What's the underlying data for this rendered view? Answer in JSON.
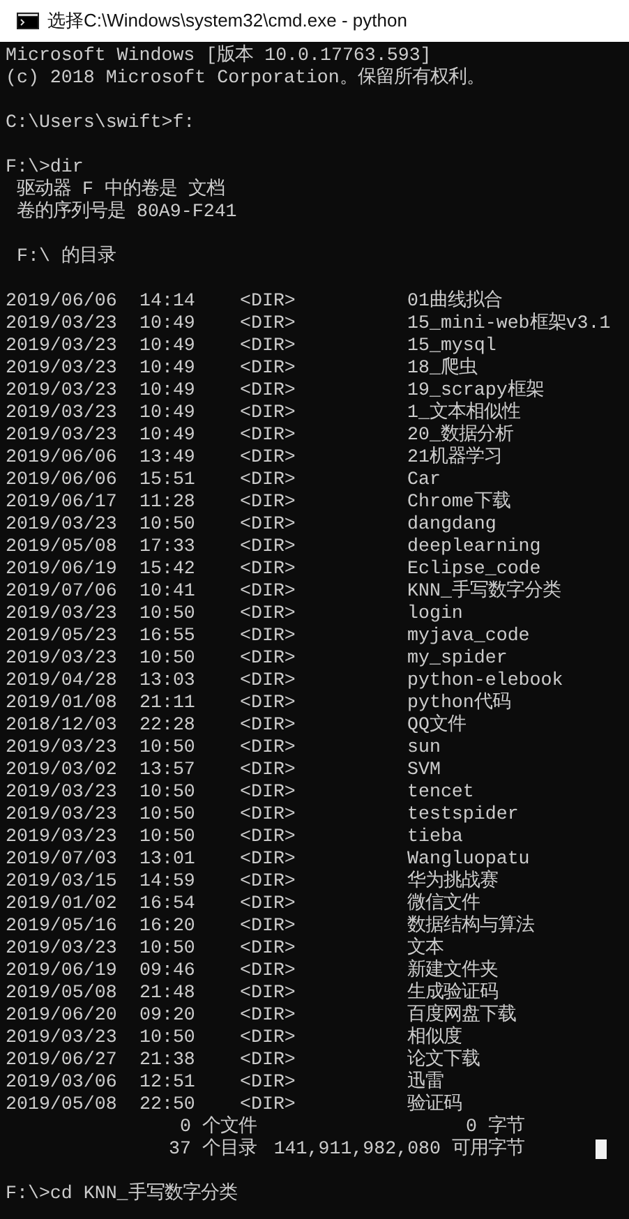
{
  "window": {
    "title": "选择C:\\Windows\\system32\\cmd.exe - python"
  },
  "console": {
    "blocks": [
      [
        "Microsoft Windows [版本 10.0.17763.593]",
        "(c) 2018 Microsoft Corporation。保留所有权利。"
      ],
      [
        "C:\\Users\\swift>f:"
      ],
      [
        "F:\\>dir",
        " 驱动器 F 中的卷是 文档",
        " 卷的序列号是 80A9-F241"
      ],
      [
        " F:\\ 的目录"
      ]
    ],
    "entries": [
      {
        "date": "2019/06/06",
        "time": "14:14",
        "type": "<DIR>",
        "name": "01曲线拟合"
      },
      {
        "date": "2019/03/23",
        "time": "10:49",
        "type": "<DIR>",
        "name": "15_mini-web框架v3.1"
      },
      {
        "date": "2019/03/23",
        "time": "10:49",
        "type": "<DIR>",
        "name": "15_mysql"
      },
      {
        "date": "2019/03/23",
        "time": "10:49",
        "type": "<DIR>",
        "name": "18_爬虫"
      },
      {
        "date": "2019/03/23",
        "time": "10:49",
        "type": "<DIR>",
        "name": "19_scrapy框架"
      },
      {
        "date": "2019/03/23",
        "time": "10:49",
        "type": "<DIR>",
        "name": "1_文本相似性"
      },
      {
        "date": "2019/03/23",
        "time": "10:49",
        "type": "<DIR>",
        "name": "20_数据分析"
      },
      {
        "date": "2019/06/06",
        "time": "13:49",
        "type": "<DIR>",
        "name": "21机器学习"
      },
      {
        "date": "2019/06/06",
        "time": "15:51",
        "type": "<DIR>",
        "name": "Car"
      },
      {
        "date": "2019/06/17",
        "time": "11:28",
        "type": "<DIR>",
        "name": "Chrome下载"
      },
      {
        "date": "2019/03/23",
        "time": "10:50",
        "type": "<DIR>",
        "name": "dangdang"
      },
      {
        "date": "2019/05/08",
        "time": "17:33",
        "type": "<DIR>",
        "name": "deeplearning"
      },
      {
        "date": "2019/06/19",
        "time": "15:42",
        "type": "<DIR>",
        "name": "Eclipse_code"
      },
      {
        "date": "2019/07/06",
        "time": "10:41",
        "type": "<DIR>",
        "name": "KNN_手写数字分类"
      },
      {
        "date": "2019/03/23",
        "time": "10:50",
        "type": "<DIR>",
        "name": "login"
      },
      {
        "date": "2019/05/23",
        "time": "16:55",
        "type": "<DIR>",
        "name": "myjava_code"
      },
      {
        "date": "2019/03/23",
        "time": "10:50",
        "type": "<DIR>",
        "name": "my_spider"
      },
      {
        "date": "2019/04/28",
        "time": "13:03",
        "type": "<DIR>",
        "name": "python-elebook"
      },
      {
        "date": "2019/01/08",
        "time": "21:11",
        "type": "<DIR>",
        "name": "python代码"
      },
      {
        "date": "2018/12/03",
        "time": "22:28",
        "type": "<DIR>",
        "name": "QQ文件"
      },
      {
        "date": "2019/03/23",
        "time": "10:50",
        "type": "<DIR>",
        "name": "sun"
      },
      {
        "date": "2019/03/02",
        "time": "13:57",
        "type": "<DIR>",
        "name": "SVM"
      },
      {
        "date": "2019/03/23",
        "time": "10:50",
        "type": "<DIR>",
        "name": "tencet"
      },
      {
        "date": "2019/03/23",
        "time": "10:50",
        "type": "<DIR>",
        "name": "testspider"
      },
      {
        "date": "2019/03/23",
        "time": "10:50",
        "type": "<DIR>",
        "name": "tieba"
      },
      {
        "date": "2019/07/03",
        "time": "13:01",
        "type": "<DIR>",
        "name": "Wangluopatu"
      },
      {
        "date": "2019/03/15",
        "time": "14:59",
        "type": "<DIR>",
        "name": "华为挑战赛"
      },
      {
        "date": "2019/01/02",
        "time": "16:54",
        "type": "<DIR>",
        "name": "微信文件"
      },
      {
        "date": "2019/05/16",
        "time": "16:20",
        "type": "<DIR>",
        "name": "数据结构与算法"
      },
      {
        "date": "2019/03/23",
        "time": "10:50",
        "type": "<DIR>",
        "name": "文本"
      },
      {
        "date": "2019/06/19",
        "time": "09:46",
        "type": "<DIR>",
        "name": "新建文件夹"
      },
      {
        "date": "2019/05/08",
        "time": "21:48",
        "type": "<DIR>",
        "name": "生成验证码"
      },
      {
        "date": "2019/06/20",
        "time": "09:20",
        "type": "<DIR>",
        "name": "百度网盘下载"
      },
      {
        "date": "2019/03/23",
        "time": "10:50",
        "type": "<DIR>",
        "name": "相似度"
      },
      {
        "date": "2019/06/27",
        "time": "21:38",
        "type": "<DIR>",
        "name": "论文下载"
      },
      {
        "date": "2019/03/06",
        "time": "12:51",
        "type": "<DIR>",
        "name": "迅雷"
      },
      {
        "date": "2019/05/08",
        "time": "22:50",
        "type": "<DIR>",
        "name": "验证码"
      }
    ],
    "summary": [
      {
        "count": "0 个文件",
        "size": "0 字节"
      },
      {
        "count": "37 个目录",
        "size": "141,911,982,080 可用字节"
      }
    ],
    "prompt": "F:\\>cd KNN_手写数字分类"
  }
}
